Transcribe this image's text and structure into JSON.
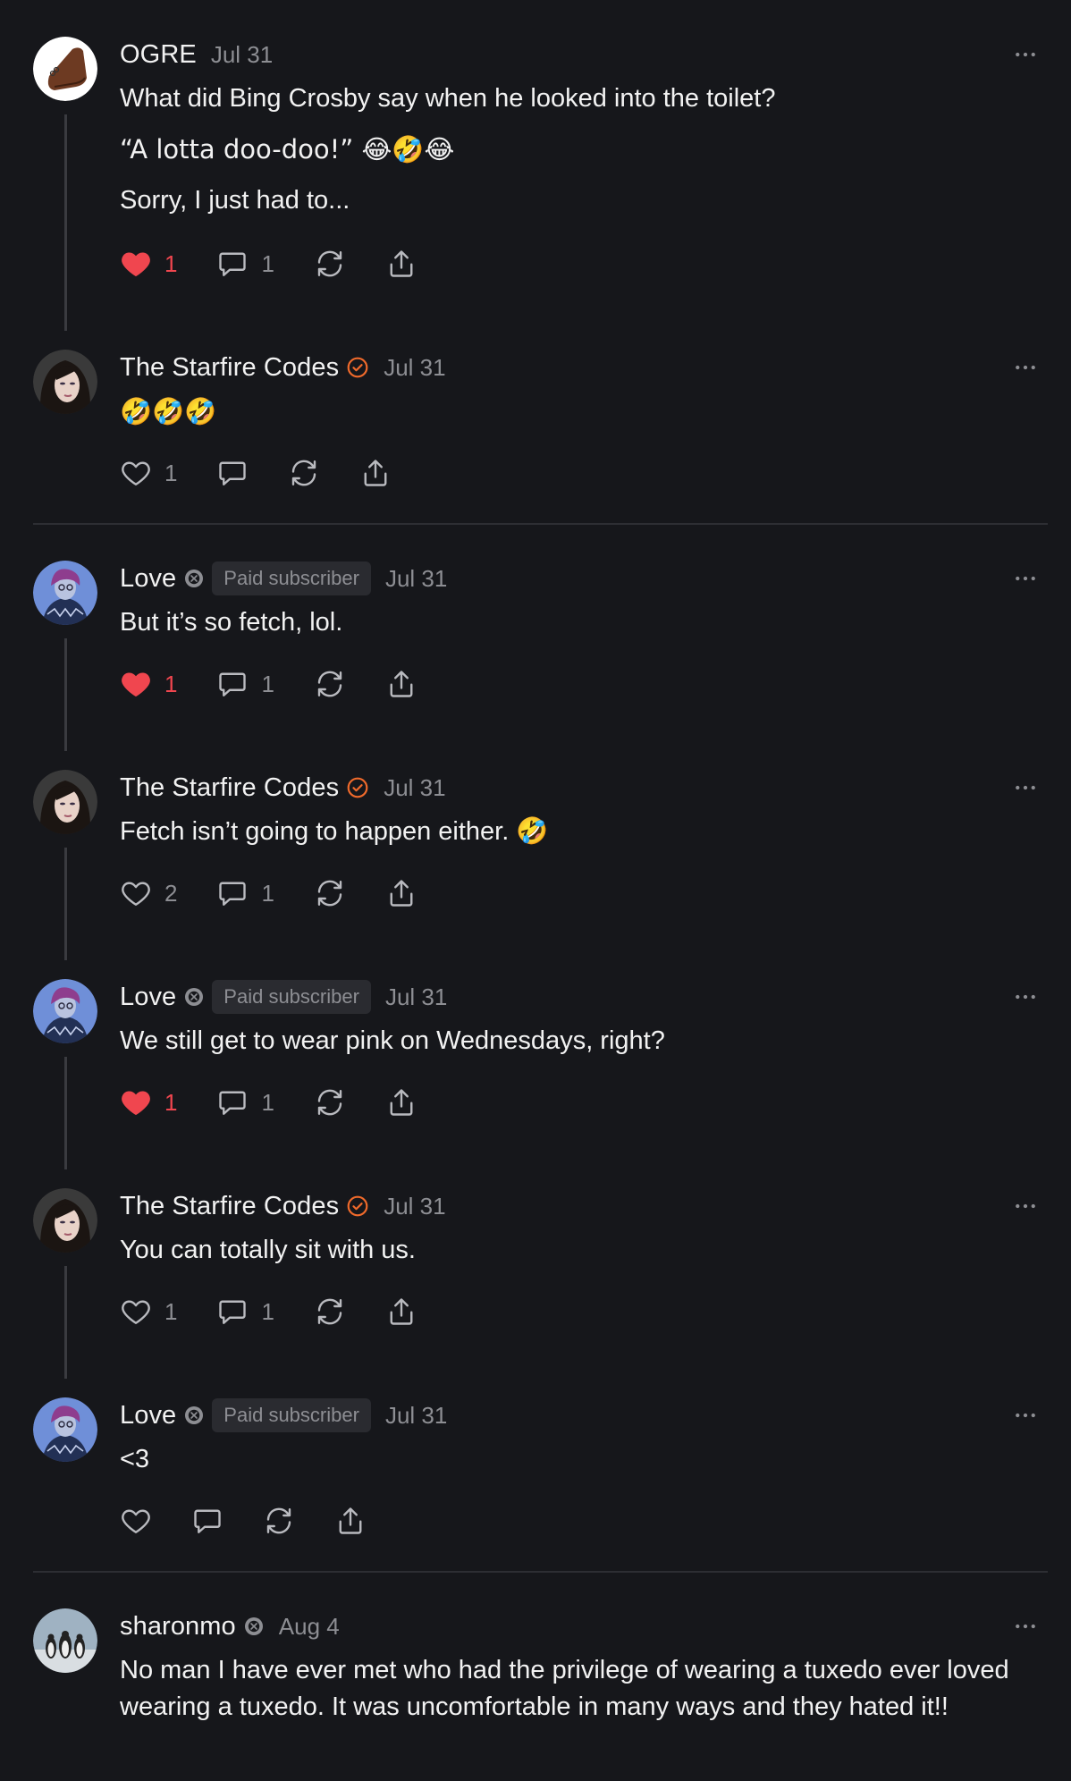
{
  "colors": {
    "background": "#16171b",
    "text": "#f2f2f2",
    "muted": "#8d8e93",
    "like_active": "#f0464f",
    "verified": "#f06a2b",
    "thread_line": "#3a3b40"
  },
  "comments": [
    {
      "author": "OGRE",
      "date": "Jul 31",
      "avatar_icon": "shoe-avatar",
      "paragraphs": [
        "What did Bing Crosby say when he looked into the toilet?",
        "“A lotta doo-doo!” 😂🤣😂",
        "Sorry, I just had to..."
      ],
      "likes": "1",
      "liked": true,
      "replies": "1"
    },
    {
      "author": "The Starfire Codes",
      "date": "Jul 31",
      "verified": true,
      "paragraphs": [
        "🤣🤣🤣"
      ],
      "likes": "1",
      "liked": false,
      "replies": ""
    },
    {
      "author": "Love",
      "date": "Jul 31",
      "subscriber_badge": "Paid subscriber",
      "paragraphs": [
        "But it’s so fetch, lol."
      ],
      "likes": "1",
      "liked": true,
      "replies": "1"
    },
    {
      "author": "The Starfire Codes",
      "date": "Jul 31",
      "verified": true,
      "paragraphs": [
        "Fetch isn’t going to happen either. 🤣"
      ],
      "likes": "2",
      "liked": false,
      "replies": "1"
    },
    {
      "author": "Love",
      "date": "Jul 31",
      "subscriber_badge": "Paid subscriber",
      "paragraphs": [
        "We still get to wear pink on Wednesdays, right?"
      ],
      "likes": "1",
      "liked": true,
      "replies": "1"
    },
    {
      "author": "The Starfire Codes",
      "date": "Jul 31",
      "verified": true,
      "paragraphs": [
        "You can totally sit with us."
      ],
      "likes": "1",
      "liked": false,
      "replies": "1"
    },
    {
      "author": "Love",
      "date": "Jul 31",
      "subscriber_badge": "Paid subscriber",
      "paragraphs": [
        "<3"
      ],
      "likes": "",
      "liked": false,
      "replies": ""
    },
    {
      "author": "sharonmo",
      "date": "Aug 4",
      "paragraphs": [
        "No man I have ever met who had the privilege of wearing a tuxedo ever loved wearing a tuxedo. It was uncomfortable in many ways and they hated it!!"
      ]
    }
  ]
}
